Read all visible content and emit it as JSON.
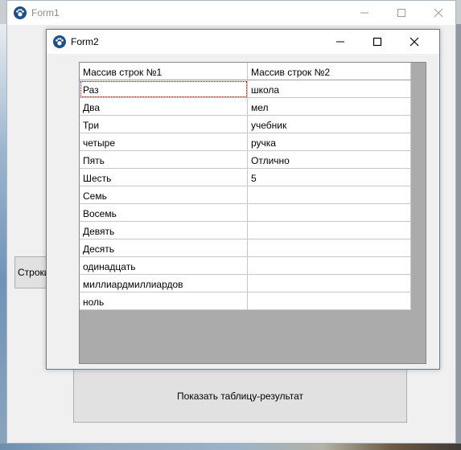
{
  "form1": {
    "title": "Form1",
    "strings_button_label": "Строки",
    "result_button_label": "Показать таблицу-результат"
  },
  "form2": {
    "title": "Form2",
    "grid": {
      "columns": [
        "Массив строк  №1",
        "Массив строк  №2"
      ],
      "rows": [
        [
          "Раз",
          "школа"
        ],
        [
          "Два",
          "мел"
        ],
        [
          "Три",
          "учебник"
        ],
        [
          "четыре",
          "ручка"
        ],
        [
          "Пять",
          "Отлично"
        ],
        [
          "Шесть",
          "5"
        ],
        [
          "Семь",
          ""
        ],
        [
          "Восемь",
          ""
        ],
        [
          "Девять",
          ""
        ],
        [
          "Десять",
          ""
        ],
        [
          "одинадцать",
          ""
        ],
        [
          "миллиардмиллиардов",
          ""
        ],
        [
          "ноль",
          ""
        ]
      ]
    }
  },
  "icons": {
    "app": "paw-icon",
    "minimize": "minimize-icon",
    "maximize": "maximize-icon",
    "close": "close-icon"
  }
}
